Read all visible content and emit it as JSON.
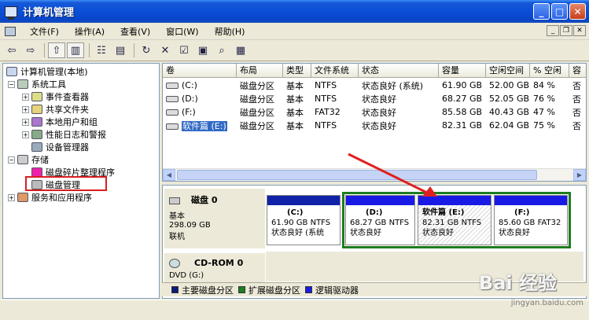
{
  "window": {
    "title": "计算机管理",
    "minimize": "_",
    "maximize": "□",
    "close": "✕"
  },
  "menu": {
    "items": [
      "文件(F)",
      "操作(A)",
      "查看(V)",
      "窗口(W)",
      "帮助(H)"
    ],
    "mdi_min": "_",
    "mdi_restore": "❐",
    "mdi_close": "✕"
  },
  "toolbar": {
    "icons": [
      "back-arrow-icon",
      "forward-arrow-icon",
      "up-folder-icon",
      "show-tree-icon",
      "properties-icon",
      "help-icon",
      "refresh-icon",
      "delete-icon",
      "check-icon",
      "paste-icon",
      "search-icon",
      "disk-props-icon"
    ]
  },
  "tree": {
    "root": "计算机管理(本地)",
    "system_tools": "系统工具",
    "event_viewer": "事件查看器",
    "shared_folders": "共享文件夹",
    "local_users": "本地用户和组",
    "perf_logs": "性能日志和警报",
    "device_manager": "设备管理器",
    "storage": "存储",
    "defrag": "磁盘碎片整理程序",
    "disk_mgmt": "磁盘管理",
    "services": "服务和应用程序",
    "expand_minus": "−",
    "expand_plus": "+"
  },
  "volume_list": {
    "columns": [
      "卷",
      "布局",
      "类型",
      "文件系统",
      "状态",
      "容量",
      "空闲空间",
      "% 空闲",
      "容"
    ],
    "rows": [
      {
        "vol": "(C:)",
        "layout": "磁盘分区",
        "type": "基本",
        "fs": "NTFS",
        "status": "状态良好 (系统)",
        "capacity": "61.90 GB",
        "free": "52.00 GB",
        "pct": "84 %",
        "ft": "否"
      },
      {
        "vol": "(D:)",
        "layout": "磁盘分区",
        "type": "基本",
        "fs": "NTFS",
        "status": "状态良好",
        "capacity": "68.27 GB",
        "free": "52.05 GB",
        "pct": "76 %",
        "ft": "否"
      },
      {
        "vol": "(F:)",
        "layout": "磁盘分区",
        "type": "基本",
        "fs": "FAT32",
        "status": "状态良好",
        "capacity": "85.58 GB",
        "free": "40.43 GB",
        "pct": "47 %",
        "ft": "否"
      },
      {
        "vol": "软件篇 (E:)",
        "layout": "磁盘分区",
        "type": "基本",
        "fs": "NTFS",
        "status": "状态良好",
        "capacity": "82.31 GB",
        "free": "62.04 GB",
        "pct": "75 %",
        "ft": "否"
      }
    ]
  },
  "disk0": {
    "name": "磁盘 0",
    "type": "基本",
    "size": "298.09 GB",
    "state": "联机",
    "partitions": [
      {
        "name": "(C:)",
        "size_fs": "61.90 GB NTFS",
        "status": "状态良好 (系统"
      },
      {
        "name": "(D:)",
        "size_fs": "68.27 GB NTFS",
        "status": "状态良好"
      },
      {
        "name": "软件篇  (E:)",
        "size_fs": "82.31 GB NTFS",
        "status": "状态良好"
      },
      {
        "name": "(F:)",
        "size_fs": "85.60 GB FAT32",
        "status": "状态良好"
      }
    ]
  },
  "cdrom0": {
    "name": "CD-ROM 0",
    "drive": "DVD (G:)"
  },
  "legend": {
    "primary": "主要磁盘分区",
    "extended": "扩展磁盘分区",
    "logical": "逻辑驱动器",
    "primary_color": "#0c1a7a",
    "extended_color": "#1d7d20",
    "logical_color": "#1a1ae6"
  },
  "annotation": {
    "arrow_color": "#e02020",
    "highlight_color": "#d81e1e"
  },
  "watermark": {
    "logo": "Bai 经验",
    "url": "jingyan.baidu.com"
  }
}
